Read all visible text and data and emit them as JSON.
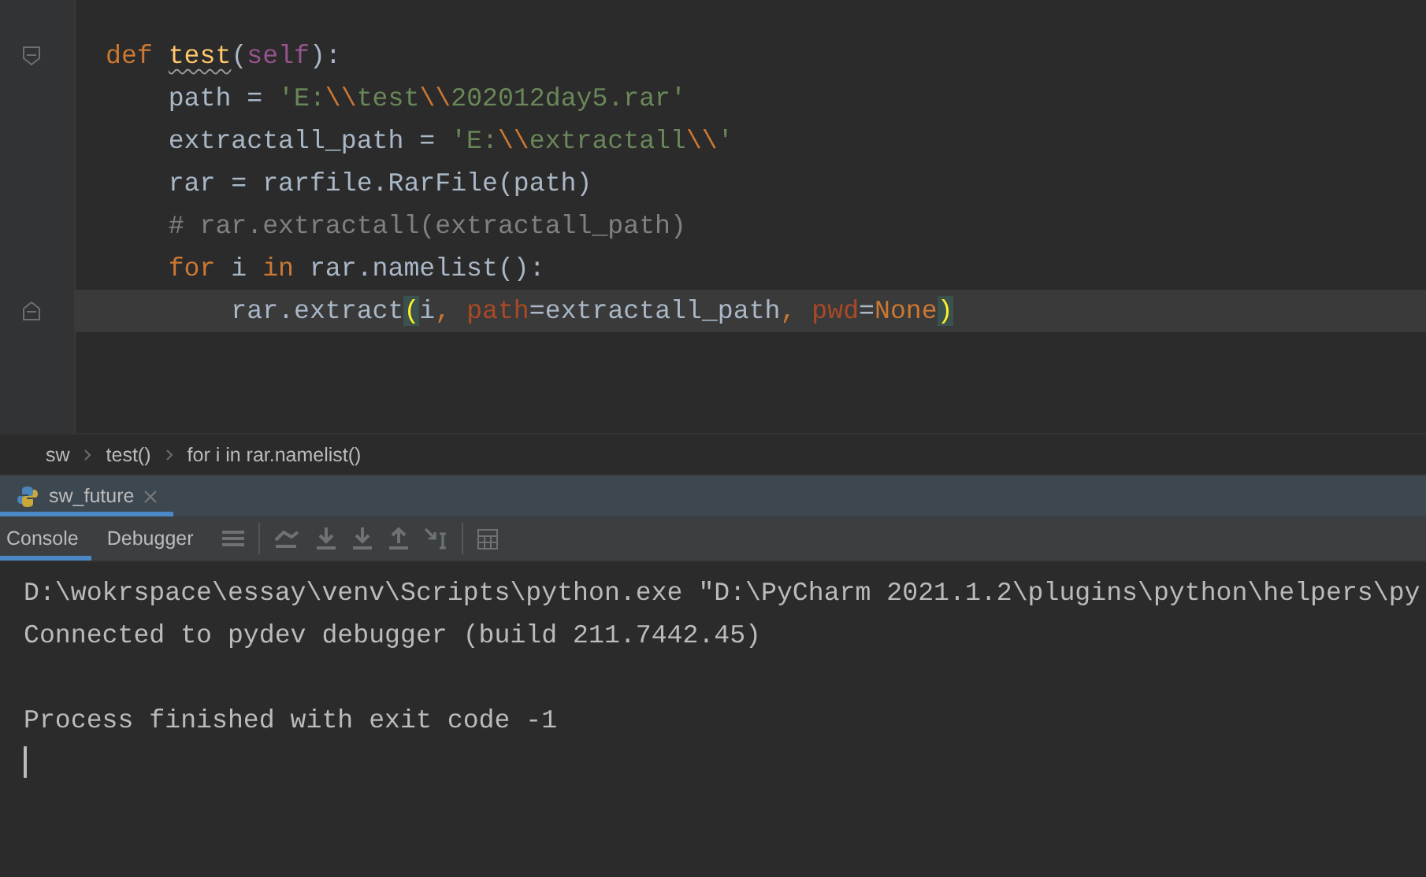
{
  "editor": {
    "lines": [
      {
        "fold_start": true,
        "current": false,
        "tokens": [
          {
            "kind": "keyword",
            "text": "def "
          },
          {
            "kind": "function",
            "text": "test"
          },
          {
            "kind": "plain",
            "text": "("
          },
          {
            "kind": "self",
            "text": "self"
          },
          {
            "kind": "plain",
            "text": "):"
          }
        ]
      },
      {
        "current": false,
        "tokens": [
          {
            "kind": "plain",
            "text": "    path = "
          },
          {
            "kind": "string",
            "text": "'E:"
          },
          {
            "kind": "escape",
            "text": "\\\\"
          },
          {
            "kind": "string",
            "text": "test"
          },
          {
            "kind": "escape",
            "text": "\\\\"
          },
          {
            "kind": "string",
            "text": "202012day5.rar'"
          }
        ]
      },
      {
        "current": false,
        "tokens": [
          {
            "kind": "plain",
            "text": "    extractall_path = "
          },
          {
            "kind": "string",
            "text": "'E:"
          },
          {
            "kind": "escape",
            "text": "\\\\"
          },
          {
            "kind": "string",
            "text": "extractall"
          },
          {
            "kind": "escape",
            "text": "\\\\"
          },
          {
            "kind": "string",
            "text": "'"
          }
        ]
      },
      {
        "current": false,
        "tokens": [
          {
            "kind": "plain",
            "text": "    rar = rarfile.RarFile(path)"
          }
        ]
      },
      {
        "current": false,
        "tokens": [
          {
            "kind": "comment",
            "text": "    # rar.extractall(extractall_path)"
          }
        ]
      },
      {
        "current": false,
        "tokens": [
          {
            "kind": "keyword",
            "text": "    for "
          },
          {
            "kind": "plain",
            "text": "i "
          },
          {
            "kind": "keyword",
            "text": "in "
          },
          {
            "kind": "plain",
            "text": "rar.namelist():"
          }
        ]
      },
      {
        "fold_end": true,
        "current": true,
        "tokens": [
          {
            "kind": "plain",
            "text": "        rar.extract"
          },
          {
            "kind": "brace",
            "text": "("
          },
          {
            "kind": "plain",
            "text": "i"
          },
          {
            "kind": "keyword",
            "text": ", "
          },
          {
            "kind": "param",
            "text": "path"
          },
          {
            "kind": "plain",
            "text": "=extractall_path"
          },
          {
            "kind": "keyword",
            "text": ", "
          },
          {
            "kind": "param",
            "text": "pwd"
          },
          {
            "kind": "plain",
            "text": "="
          },
          {
            "kind": "keyword",
            "text": "None"
          },
          {
            "kind": "brace",
            "text": ")"
          }
        ]
      }
    ]
  },
  "breadcrumbs": [
    "sw",
    "test()",
    "for i in rar.namelist()"
  ],
  "run_tabs": [
    {
      "label": "sw_future",
      "selected": true
    }
  ],
  "debug_tabs": [
    {
      "label": "Console",
      "selected": true
    },
    {
      "label": "Debugger",
      "selected": false
    }
  ],
  "console_blocks": [
    [
      "D:\\wokrspace\\essay\\venv\\Scripts\\python.exe \"D:\\PyCharm 2021.1.2\\plugins\\python\\helpers\\py",
      "Connected to pydev debugger (build 211.7442.45)"
    ],
    [
      "Process finished with exit code -1"
    ]
  ]
}
